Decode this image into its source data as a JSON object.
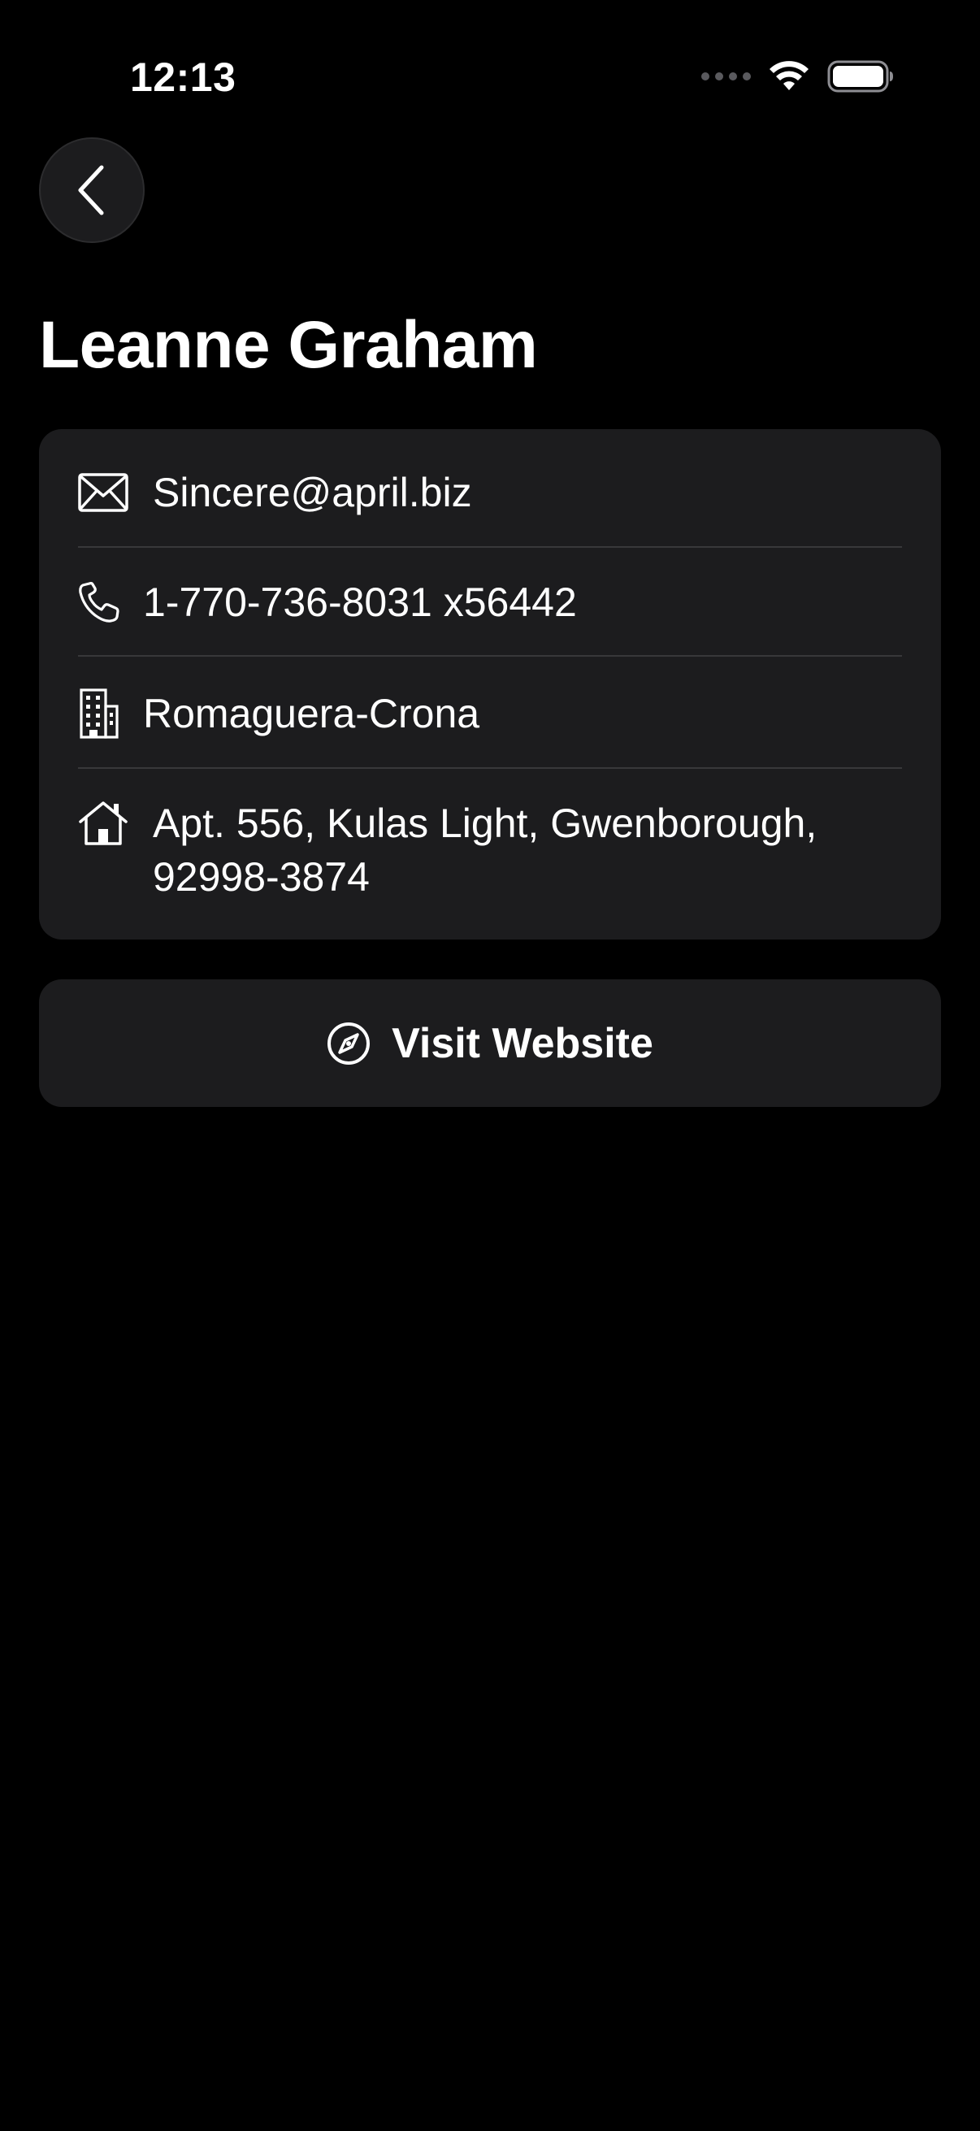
{
  "status_bar": {
    "time": "12:13"
  },
  "header": {
    "back_icon": "chevron-left-icon",
    "title": "Leanne Graham"
  },
  "contact": {
    "email": "Sincere@april.biz",
    "phone": "1-770-736-8031 x56442",
    "company": "Romaguera-Crona",
    "address_line1": "Apt. 556, Kulas Light, Gwenborough,",
    "address_line2": "92998-3874"
  },
  "actions": {
    "visit_website_label": "Visit Website"
  },
  "icons": {
    "email": "envelope-icon",
    "phone": "phone-icon",
    "company": "building-icon",
    "address": "house-icon",
    "website": "compass-icon"
  },
  "colors": {
    "background": "#000000",
    "card": "#1c1c1e",
    "divider": "#38383a",
    "text": "#ffffff"
  }
}
